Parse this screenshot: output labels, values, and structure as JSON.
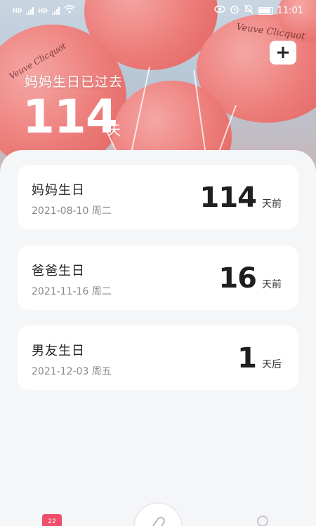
{
  "status_bar": {
    "time": "11:01",
    "left_icons": [
      "hd-icon",
      "signal-icon",
      "hd-icon",
      "signal-icon",
      "wifi-icon"
    ],
    "right_icons": [
      "eye-icon",
      "alarm-icon",
      "mute-icon",
      "battery-icon"
    ]
  },
  "hero": {
    "title": "妈妈生日已过去",
    "count": "114",
    "unit": "天",
    "brand_text_1": "Veuve Clicquot",
    "brand_text_2": "Veuve Clicquot"
  },
  "add_button": {
    "label": "+"
  },
  "events": [
    {
      "title": "妈妈生日",
      "date": "2021-08-10 周二",
      "days": "114",
      "relative": "天前"
    },
    {
      "title": "爸爸生日",
      "date": "2021-11-16 周二",
      "days": "16",
      "relative": "天前"
    },
    {
      "title": "男友生日",
      "date": "2021-12-03 周五",
      "days": "1",
      "relative": "天后"
    }
  ],
  "tab_bar": {
    "calendar_day": "22",
    "items": [
      "calendar-icon",
      "paperclip-icon",
      "face-icon"
    ]
  },
  "colors": {
    "balloon": "#ec7b78",
    "tab_accent": "#ee4f6a",
    "background": "#f5f6f8"
  }
}
